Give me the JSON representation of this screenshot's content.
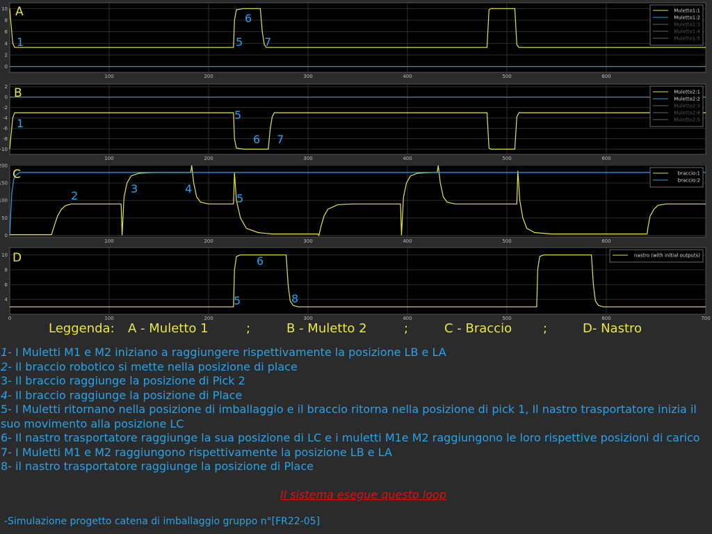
{
  "colors": {
    "plot_bg": "#000000",
    "grid": "#2e2e2e",
    "yellow": "#e8e840",
    "blue": "#2aa3e8",
    "red": "#e01010",
    "page_bg": "#2b2b2b"
  },
  "chart_data": [
    {
      "type": "line",
      "panel_label": "A",
      "xlim": [
        0,
        700
      ],
      "ylim": [
        -1,
        11
      ],
      "yticks": [
        0,
        2,
        4,
        6,
        8,
        10
      ],
      "xticks": [
        100,
        200,
        300,
        400,
        500,
        600
      ],
      "grid": true,
      "legend_position": "top-right",
      "legend": [
        "Muletto1:1",
        "Muletto1:2",
        "Muletto1:3",
        "Muletto1:4",
        "Muletto1:5"
      ],
      "series": [
        {
          "name": "Muletto1:1",
          "color": "#e8e840",
          "x": [
            0,
            1,
            3,
            5,
            225,
            226,
            228,
            235,
            236,
            252,
            254,
            256,
            258,
            480,
            482,
            484,
            508,
            510,
            512,
            700
          ],
          "y": [
            10,
            8,
            4,
            3.3,
            3.3,
            8,
            9.8,
            10,
            10,
            10,
            6,
            3.8,
            3.3,
            3.3,
            9.8,
            10,
            10,
            3.8,
            3.3,
            3.3
          ]
        },
        {
          "name": "Muletto1:2",
          "color": "#2aa3e8",
          "x": [
            0,
            700
          ],
          "y": [
            0,
            0
          ]
        }
      ],
      "annotations": [
        {
          "text": "A",
          "color": "#e8e840"
        },
        {
          "text": "1",
          "color": "#2aa3e8"
        },
        {
          "text": "6",
          "color": "#2aa3e8"
        },
        {
          "text": "5",
          "color": "#2aa3e8"
        },
        {
          "text": "7",
          "color": "#2aa3e8"
        }
      ]
    },
    {
      "type": "line",
      "panel_label": "B",
      "xlim": [
        0,
        700
      ],
      "ylim": [
        -11,
        2.5
      ],
      "yticks": [
        -10,
        -8,
        -6,
        -4,
        -2,
        0,
        2
      ],
      "xticks": [
        100,
        200,
        300,
        400,
        500,
        600
      ],
      "grid": true,
      "legend_position": "top-right",
      "legend": [
        "Muletto2:1",
        "Muletto2:2",
        "Muletto2:3",
        "Muletto2:4",
        "Muletto2:5"
      ],
      "series": [
        {
          "name": "Muletto2:1",
          "color": "#e8e840",
          "x": [
            0,
            1,
            3,
            5,
            225,
            226,
            228,
            235,
            236,
            260,
            262,
            264,
            266,
            480,
            482,
            484,
            508,
            510,
            512,
            700
          ],
          "y": [
            -10,
            -8,
            -4,
            -3,
            -3,
            -8,
            -9.8,
            -10,
            -10,
            -10,
            -6,
            -3.8,
            -3,
            -3,
            -9.8,
            -10,
            -10,
            -3.8,
            -3,
            -3
          ]
        },
        {
          "name": "Muletto2:2",
          "color": "#2aa3e8",
          "x": [
            0,
            700
          ],
          "y": [
            0,
            0
          ]
        }
      ],
      "annotations": [
        {
          "text": "B",
          "color": "#e8e840"
        },
        {
          "text": "1",
          "color": "#2aa3e8"
        },
        {
          "text": "5",
          "color": "#2aa3e8"
        },
        {
          "text": "6",
          "color": "#2aa3e8"
        },
        {
          "text": "7",
          "color": "#2aa3e8"
        }
      ]
    },
    {
      "type": "line",
      "panel_label": "C",
      "xlim": [
        0,
        700
      ],
      "ylim": [
        -5,
        200
      ],
      "yticks": [
        0,
        50,
        100,
        150,
        200
      ],
      "xticks": [
        100,
        200,
        300,
        400,
        500,
        600
      ],
      "grid": true,
      "legend_position": "top-right",
      "legend": [
        "braccio:1",
        "braccio:2"
      ],
      "series": [
        {
          "name": "braccio:1",
          "color": "#e8e840",
          "x": [
            0,
            42,
            44,
            48,
            52,
            56,
            62,
            112,
            113,
            115,
            118,
            122,
            130,
            145,
            182,
            183,
            185,
            188,
            192,
            200,
            225,
            226,
            228,
            232,
            238,
            250,
            264,
            310,
            311,
            313,
            316,
            320,
            330,
            345,
            393,
            394,
            396,
            399,
            403,
            410,
            425,
            430,
            431,
            433,
            436,
            440,
            448,
            460,
            510,
            511,
            513,
            516,
            520,
            528,
            545,
            600,
            641,
            642,
            644,
            648,
            652,
            660,
            670,
            700
          ],
          "y": [
            2,
            2,
            20,
            55,
            75,
            85,
            90,
            90,
            0,
            110,
            150,
            170,
            178,
            180,
            180,
            200,
            150,
            110,
            95,
            90,
            90,
            180,
            100,
            50,
            20,
            8,
            4,
            4,
            0,
            25,
            55,
            75,
            88,
            90,
            90,
            0,
            110,
            150,
            170,
            178,
            180,
            180,
            200,
            150,
            110,
            95,
            90,
            90,
            90,
            185,
            100,
            50,
            20,
            8,
            4,
            4,
            4,
            25,
            55,
            75,
            86,
            90,
            90,
            90
          ]
        },
        {
          "name": "braccio:2",
          "color": "#2aa3e8",
          "x": [
            0,
            2,
            4,
            6,
            10,
            700
          ],
          "y": [
            0,
            120,
            160,
            172,
            180,
            180
          ]
        }
      ],
      "annotations": [
        {
          "text": "C",
          "color": "#e8e840"
        },
        {
          "text": "2",
          "color": "#2aa3e8"
        },
        {
          "text": "3",
          "color": "#2aa3e8"
        },
        {
          "text": "4",
          "color": "#2aa3e8"
        },
        {
          "text": "5",
          "color": "#2aa3e8"
        }
      ]
    },
    {
      "type": "line",
      "panel_label": "D",
      "xlim": [
        0,
        700
      ],
      "ylim": [
        2,
        11
      ],
      "yticks": [
        4,
        6,
        8,
        10
      ],
      "xticks": [
        0,
        100,
        200,
        300,
        400,
        500,
        600,
        700
      ],
      "grid": true,
      "legend_position": "top-right",
      "legend": [
        "nastro (with initial outputs)"
      ],
      "series": [
        {
          "name": "nastro (with initial outputs)",
          "color": "#e8e840",
          "x": [
            0,
            225,
            226,
            228,
            232,
            278,
            280,
            282,
            285,
            290,
            530,
            531,
            533,
            537,
            585,
            587,
            589,
            592,
            597,
            700
          ],
          "y": [
            3,
            3,
            8,
            9.8,
            10,
            10,
            6,
            3.8,
            3.2,
            3,
            3,
            8,
            9.8,
            10,
            10,
            6,
            3.8,
            3.2,
            3,
            3
          ]
        }
      ],
      "annotations": [
        {
          "text": "D",
          "color": "#e8e840"
        },
        {
          "text": "6",
          "color": "#2aa3e8"
        },
        {
          "text": "5",
          "color": "#2aa3e8"
        },
        {
          "text": "8",
          "color": "#2aa3e8"
        }
      ]
    }
  ],
  "legend_line": {
    "title": "Leggenda:",
    "items": [
      "A - Muletto 1",
      ";",
      "B - Muletto 2",
      ";",
      "C - Braccio",
      ";",
      "D- Nastro"
    ]
  },
  "notes": [
    {
      "num": "1-",
      "text": " I Muletti M1 e M2 iniziano a raggiungere rispettivamente la posizione LB e LA"
    },
    {
      "num": "2-",
      "text": " Il braccio robotico si mette nella posizione di place"
    },
    {
      "num": "3-",
      "text": " Il braccio raggiunge la posizione di Pick 2"
    },
    {
      "num": "4-",
      "text": " Il braccio raggiunge la posizione di Place"
    },
    {
      "num": "5-",
      "text": " I Muletti ritornano nella posizione di imballaggio e il braccio ritorna nella posizione di pick 1, Il nastro trasportatore inizia il suo movimento alla posizione LC"
    },
    {
      "num": "6-",
      "text": " Il nastro trasportatore raggiunge la sua posizione di LC e i muletti M1e M2 raggiungono le loro rispettive posizioni di carico"
    },
    {
      "num": "7-",
      "text": " I Muletti M1 e M2 raggiungono rispettivamente la posizione LB e LA"
    },
    {
      "num": "8-",
      "text": " il nastro trasportatore raggiunge la posizione di Place"
    }
  ],
  "loop_text": "Il sistema esegue questo loop",
  "footer": "-Simulazione progetto catena di imballaggio gruppo n°[FR22-05]"
}
